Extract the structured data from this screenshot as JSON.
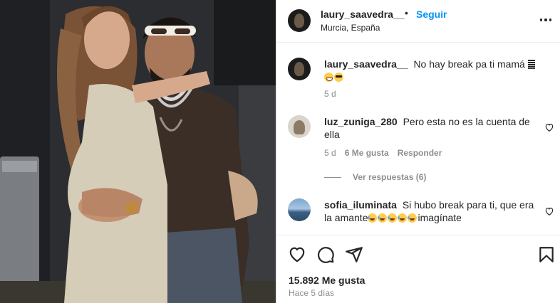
{
  "header": {
    "username": "laury_saavedra__",
    "separator": "•",
    "follow_label": "Seguir",
    "location": "Murcia, España"
  },
  "caption": {
    "username": "laury_saavedra__",
    "text": "No hay break pa ti mamá",
    "emoji": [
      "grinning-face-with-sweat",
      "smiling-face-with-sunglasses"
    ],
    "age": "5 d"
  },
  "comments": [
    {
      "username": "luz_zuniga_280",
      "text": "Pero esta no es la cuenta de ella",
      "age": "5 d",
      "likes": "6 Me gusta",
      "reply_label": "Responder",
      "view_replies": "Ver respuestas (6)"
    },
    {
      "username": "sofia_iluminata",
      "text_before": "Si hubo break para ti, que era la amante",
      "text_after": "imagínate",
      "emoji": [
        "face-with-tears-of-joy",
        "face-with-tears-of-joy",
        "face-with-tears-of-joy",
        "face-with-tears-of-joy",
        "face-with-tears-of-joy"
      ]
    }
  ],
  "footer": {
    "likes": "15.892 Me gusta",
    "time": "Hace 5 días"
  },
  "colors": {
    "link_blue": "#0095f6",
    "text": "#262626",
    "muted": "#8e8e8e",
    "border": "#dbdbdb"
  }
}
